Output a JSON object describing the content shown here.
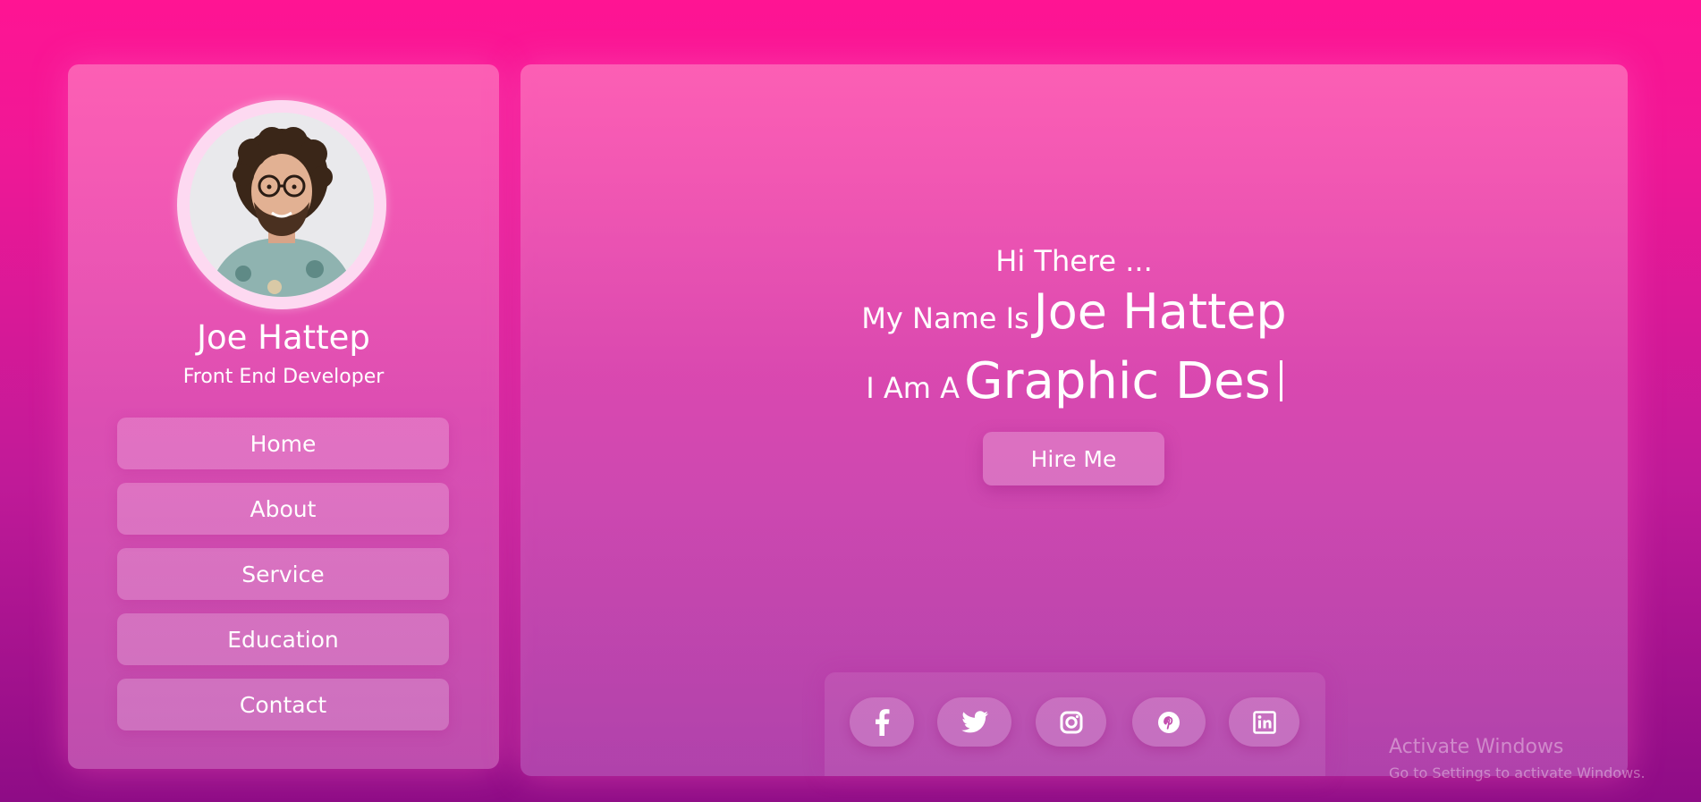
{
  "colors": {
    "background_top": "#ff1493",
    "background_bottom": "#8e0c86",
    "card": "#e97fca",
    "text": "#ffffff"
  },
  "sidebar": {
    "name": "Joe Hattep",
    "role": "Front End Developer",
    "nav": [
      {
        "label": "Home"
      },
      {
        "label": "About"
      },
      {
        "label": "Service"
      },
      {
        "label": "Education"
      },
      {
        "label": "Contact"
      }
    ]
  },
  "hero": {
    "greeting": "Hi There ...",
    "name_prefix": "My Name Is",
    "name": "Joe Hattep",
    "role_prefix": "I Am A",
    "role_typed": "Graphic Des",
    "hire_button": "Hire Me"
  },
  "social": [
    {
      "icon": "facebook-icon"
    },
    {
      "icon": "twitter-icon"
    },
    {
      "icon": "instagram-icon"
    },
    {
      "icon": "pinterest-icon"
    },
    {
      "icon": "linkedin-icon"
    }
  ],
  "watermark": {
    "title": "Activate Windows",
    "subtitle": "Go to Settings to activate Windows."
  }
}
